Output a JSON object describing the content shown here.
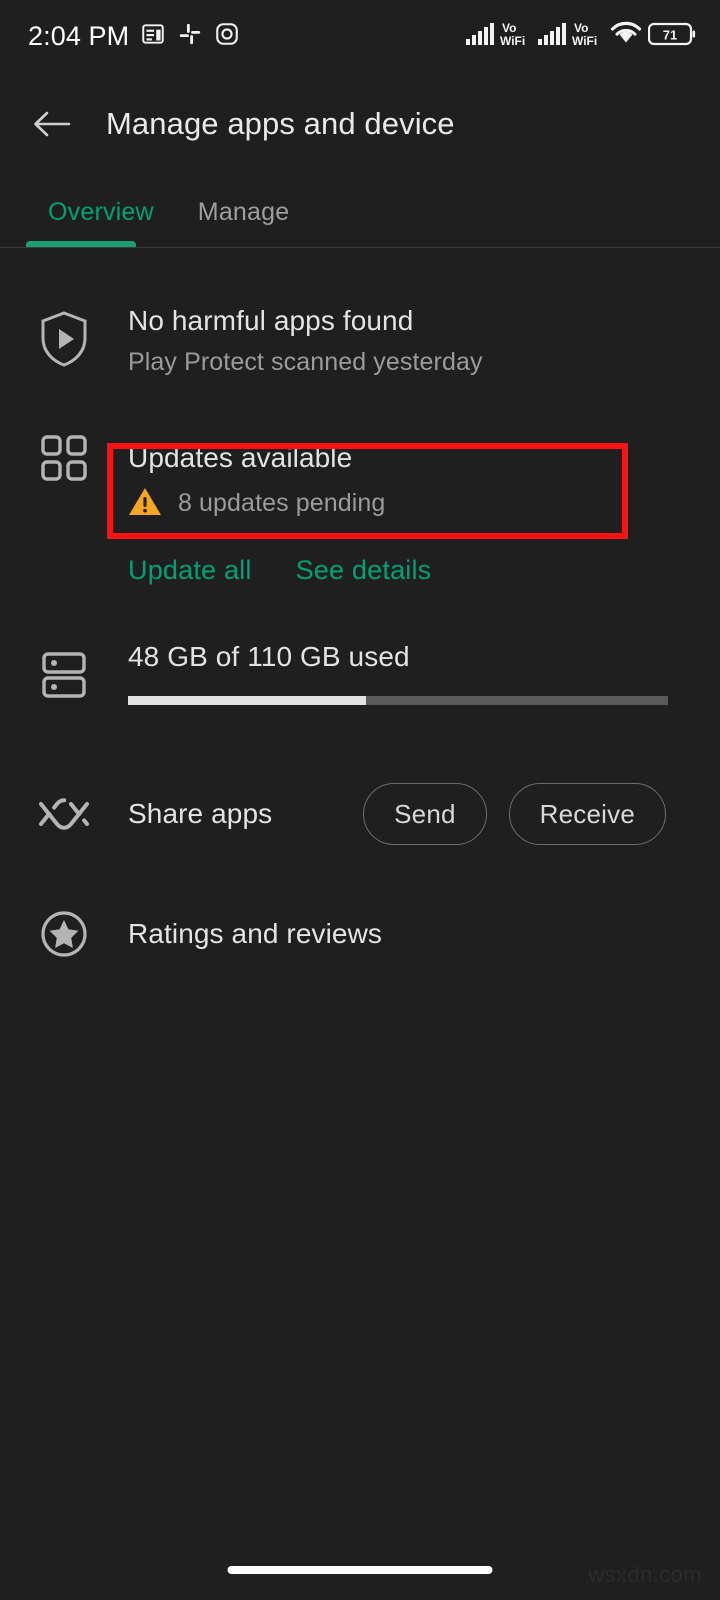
{
  "status_bar": {
    "time": "2:04 PM",
    "notification_icons": [
      "news-icon",
      "slack-icon",
      "instagram-icon"
    ],
    "signal_labels": [
      "Vo",
      "WiFi",
      "Vo",
      "WiFi"
    ],
    "vo_label": "Vo",
    "wifi_label": "WiFi",
    "battery_level": "71"
  },
  "app_bar": {
    "back_label": "back-arrow",
    "title": "Manage apps and device"
  },
  "tabs": [
    {
      "label": "Overview",
      "active": true
    },
    {
      "label": "Manage",
      "active": false
    }
  ],
  "sections": {
    "play_protect": {
      "icon": "shield-play-icon",
      "title": "No harmful apps found",
      "subtitle": "Play Protect scanned yesterday"
    },
    "updates": {
      "icon": "apps-grid-icon",
      "title": "Updates available",
      "warning_icon": "warning-triangle-icon",
      "subtitle": "8 updates pending",
      "update_all_label": "Update all",
      "see_details_label": "See details"
    },
    "storage": {
      "icon": "storage-icon",
      "title": "48 GB of 110 GB used",
      "used_gb": 48,
      "total_gb": 110,
      "percent_used": 44
    },
    "share_apps": {
      "icon": "share-apps-icon",
      "label": "Share apps",
      "send_label": "Send",
      "receive_label": "Receive"
    },
    "ratings": {
      "icon": "star-circle-icon",
      "label": "Ratings and reviews"
    }
  },
  "annotation": {
    "type": "highlight-rectangle",
    "color": "#fb1212",
    "target": "Updates available"
  },
  "colors": {
    "background": "#1f1f1f",
    "accent_green": "#00a173",
    "warning_amber": "#f5a623",
    "annotation_red": "#fb1212",
    "primary_text": "#e3e3e3",
    "secondary_text": "#9b9b9b"
  },
  "watermark": "wsxdn.com"
}
